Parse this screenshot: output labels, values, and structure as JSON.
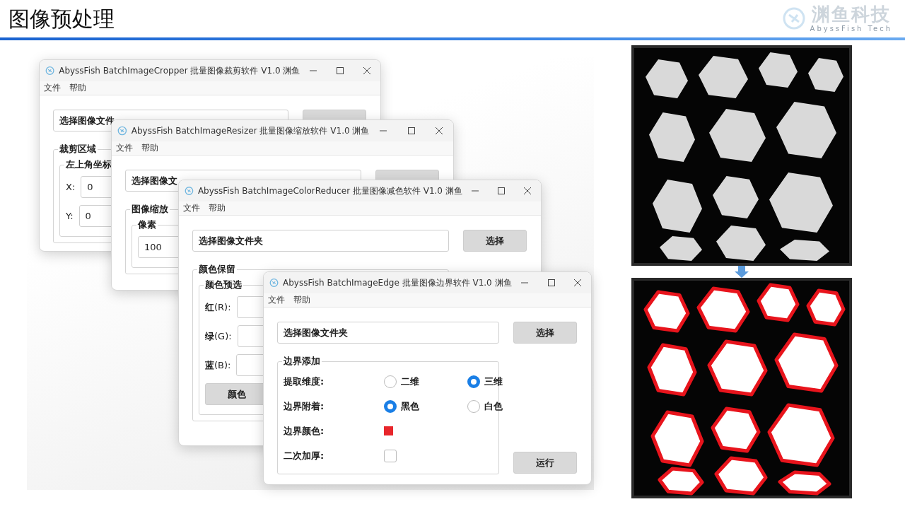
{
  "slide": {
    "title": "图像预处理",
    "logo": {
      "name": "渊鱼科技",
      "tagline": "AbyssFish Tech"
    }
  },
  "windows": [
    {
      "title": "AbyssFish BatchImageCropper 批量图像裁剪软件 V1.0 渊鱼",
      "menu": [
        "文件",
        "帮助"
      ],
      "folder_field": "选择图像文件",
      "group": {
        "title": "裁剪区域",
        "subgroup": {
          "title": "左上角坐标",
          "rows": [
            {
              "kind": "input",
              "label": "X:",
              "value": "0"
            },
            {
              "kind": "input",
              "label": "Y:",
              "value": "0"
            }
          ]
        }
      }
    },
    {
      "title": "AbyssFish BatchImageResizer 批量图像缩放软件 V1.0 渊鱼",
      "menu": [
        "文件",
        "帮助"
      ],
      "folder_field": "选择图像文",
      "group": {
        "title": "图像缩放",
        "subgroup": {
          "title": "像素",
          "rows": [
            {
              "kind": "input",
              "value": "100"
            }
          ]
        }
      }
    },
    {
      "title": "AbyssFish BatchImageColorReducer 批量图像减色软件 V1.0 渊鱼",
      "menu": [
        "文件",
        "帮助"
      ],
      "folder_field": "选择图像文件夹",
      "select_button": "选择",
      "group": {
        "title": "颜色保留",
        "subgroup": {
          "title": "颜色预选",
          "rows": [
            {
              "kind": "input",
              "label": "**红**(R):"
            },
            {
              "kind": "input",
              "label": "**绿**(G):"
            },
            {
              "kind": "input",
              "label": "**蓝**(B):"
            },
            {
              "kind": "button",
              "label": "颜色"
            }
          ]
        }
      }
    },
    {
      "title": "AbyssFish BatchImageEdge 批量图像边界软件 V1.0 渊鱼",
      "menu": [
        "文件",
        "帮助"
      ],
      "folder_field": "选择图像文件夹",
      "select_button": "选择",
      "group": {
        "title": "边界添加",
        "rows": [
          {
            "kind": "radio",
            "label": "提取维度:",
            "options": [
              {
                "label": "二维",
                "selected": false
              },
              {
                "label": "三维",
                "selected": true
              }
            ]
          },
          {
            "kind": "radio",
            "label": "边界附着:",
            "options": [
              {
                "label": "黑色",
                "selected": true
              },
              {
                "label": "白色",
                "selected": false
              }
            ]
          },
          {
            "kind": "color",
            "label": "边界颜色:",
            "color": "#e8262b"
          },
          {
            "kind": "checkbox",
            "label": "二次加厚:",
            "checked": false
          }
        ]
      },
      "run_button": "运行"
    }
  ]
}
